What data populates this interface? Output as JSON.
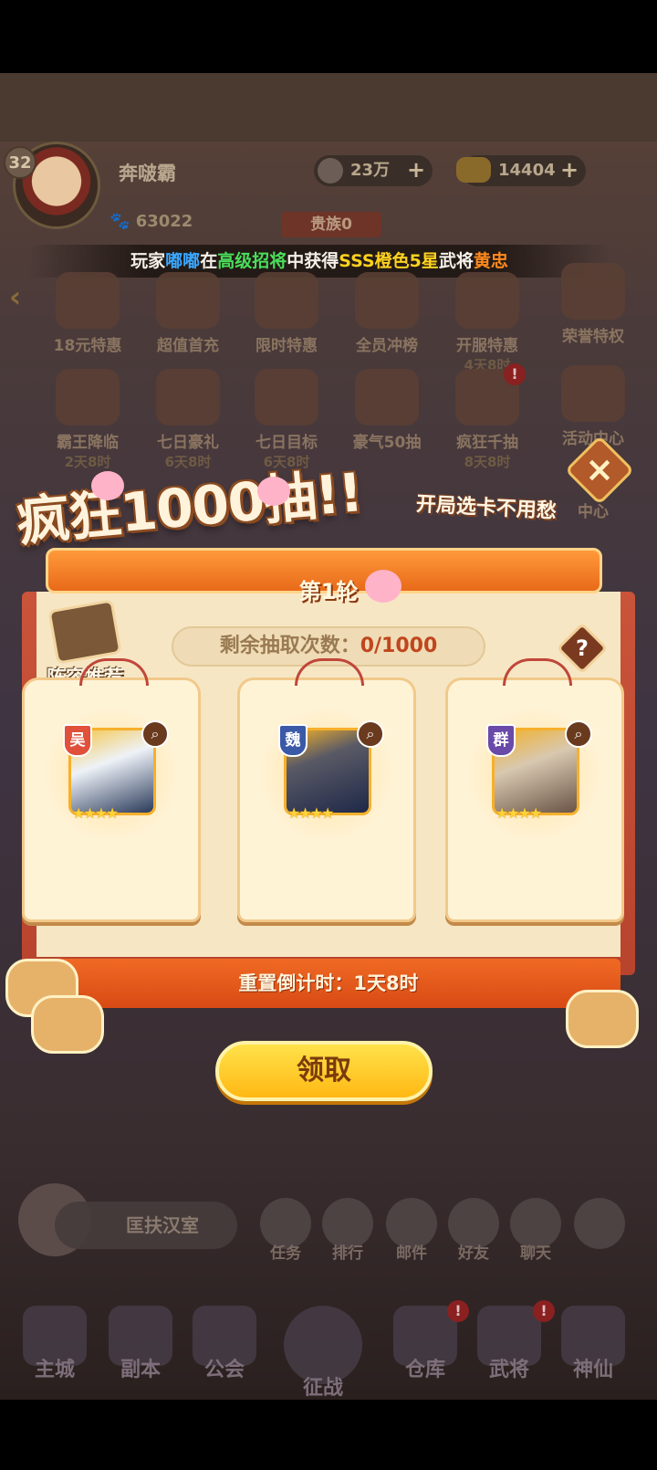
{
  "hud": {
    "level": "32",
    "player_name": "奔啵霸",
    "silver": "23万",
    "gold": "14404",
    "paw_points": "63022",
    "noble": "贵族0"
  },
  "ticker": {
    "prefix": "玩家",
    "player": "嘟嘟",
    "in": "在",
    "event": "高级招将",
    "middle": "中获得",
    "tier": "SSS橙色5星",
    "hero_label": "武将",
    "hero": "黄忠"
  },
  "activities": [
    {
      "label": "18元特惠",
      "sub": ""
    },
    {
      "label": "超值首充",
      "sub": ""
    },
    {
      "label": "限时特惠",
      "sub": ""
    },
    {
      "label": "全员冲榜",
      "sub": ""
    },
    {
      "label": "开服特惠",
      "sub": "4天8时"
    },
    {
      "label": "荣誉特权",
      "sub": ""
    },
    {
      "label": "霸王降临",
      "sub": "2天8时"
    },
    {
      "label": "七日豪礼",
      "sub": "6天8时"
    },
    {
      "label": "七日目标",
      "sub": "6天8时"
    },
    {
      "label": "豪气50抽",
      "sub": ""
    },
    {
      "label": "疯狂千抽",
      "sub": "8天8时"
    },
    {
      "label": "活动中心",
      "sub": ""
    },
    {
      "label": "中心",
      "sub": ""
    }
  ],
  "popup": {
    "title": "疯狂1000抽!!",
    "subtitle": "开局选卡不用愁",
    "round": "第1轮",
    "counter_label": "剩余抽取次数：",
    "counter_value": "0/1000",
    "help": "?",
    "close": "×",
    "lineup": "阵容推荐",
    "heroes": [
      {
        "faction": "吴",
        "faction_color": "#e0503a",
        "stars": 4
      },
      {
        "faction": "魏",
        "faction_color": "#3a5aa8",
        "stars": 4
      },
      {
        "faction": "群",
        "faction_color": "#6a4aa8",
        "stars": 4
      }
    ],
    "reset": "重置倒计时：1天8时",
    "claim": "领取"
  },
  "lower": {
    "quest": "匡扶汉室",
    "mini": [
      "任务",
      "排行",
      "邮件",
      "好友",
      "聊天",
      ""
    ],
    "nav": [
      "主城",
      "副本",
      "公会",
      "征战",
      "仓库",
      "武将",
      "神仙"
    ]
  }
}
